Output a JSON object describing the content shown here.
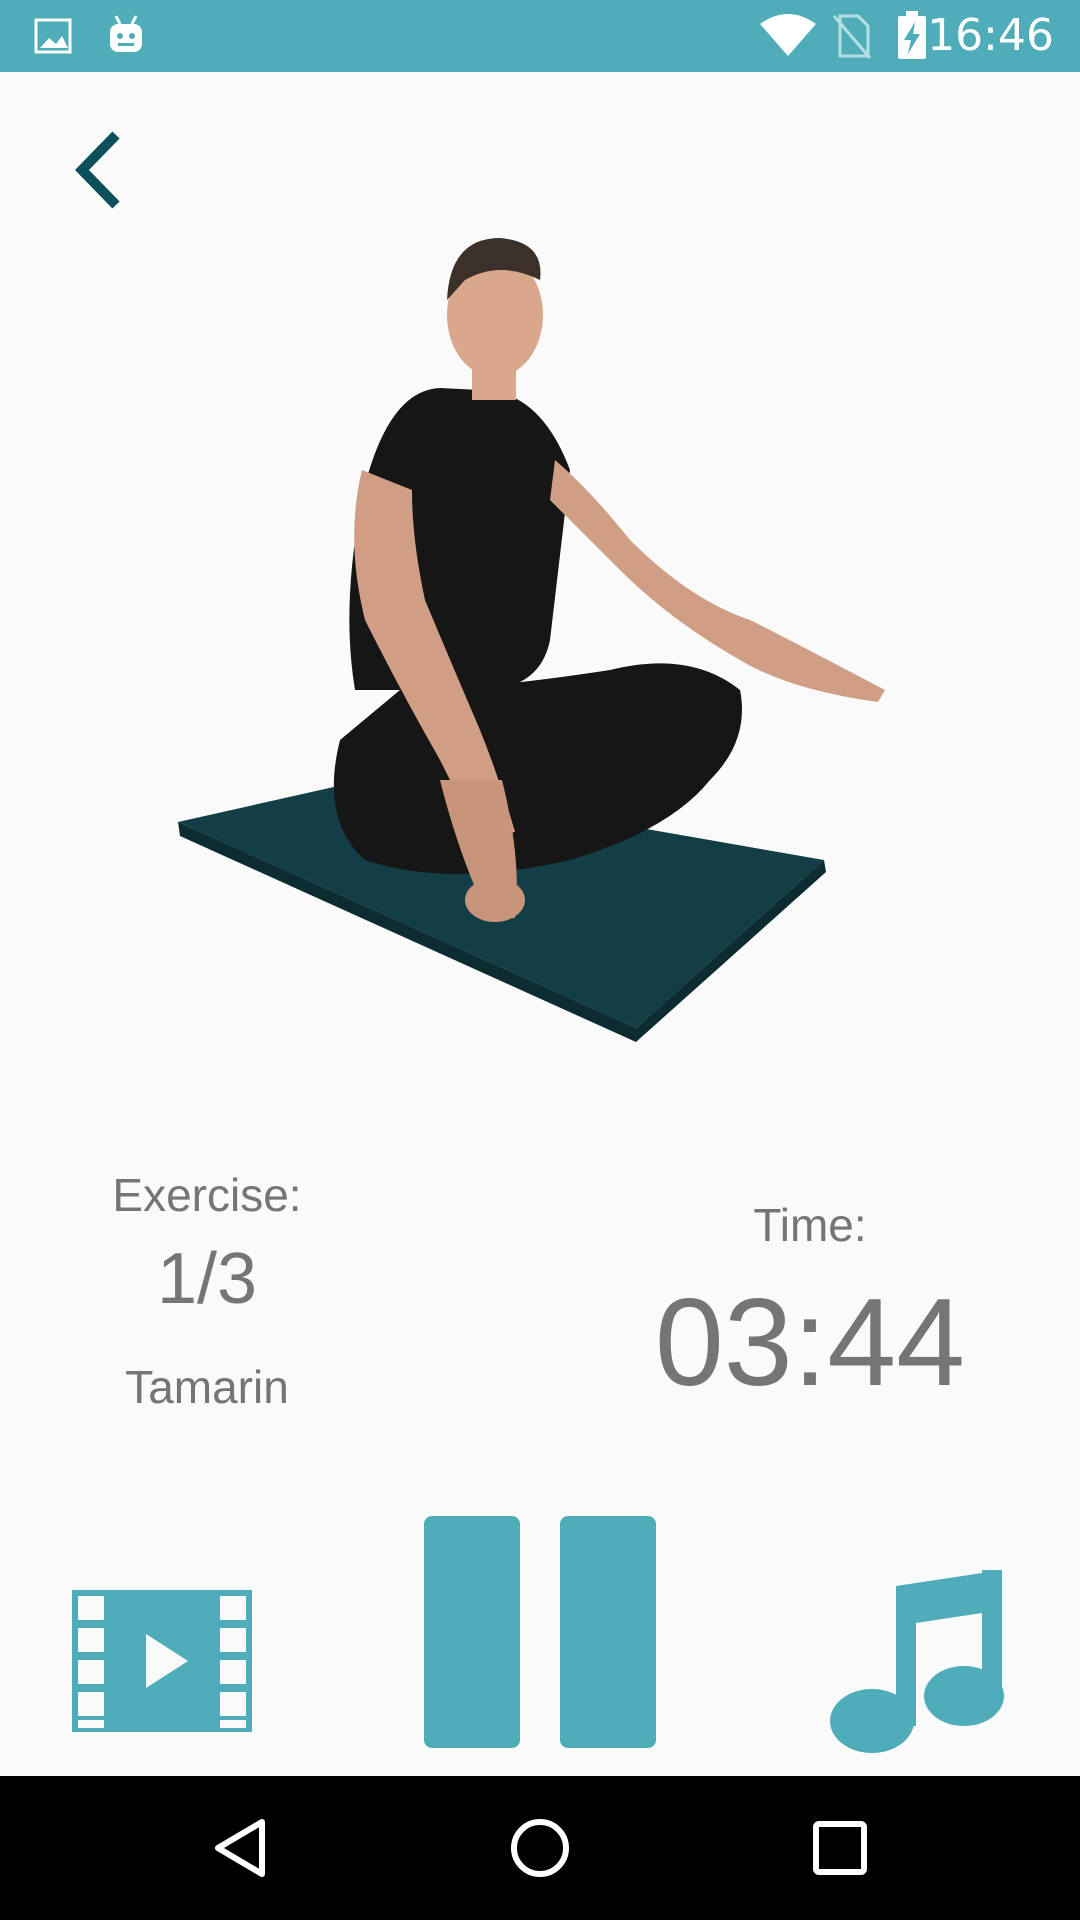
{
  "status_bar": {
    "time": "16:46",
    "background_color": "#4eadb8",
    "icons": [
      "gallery-notification-icon",
      "android-notification-icon",
      "wifi-icon",
      "no-sim-icon",
      "battery-charging-icon"
    ]
  },
  "header": {
    "back_icon": "chevron-left-icon"
  },
  "exercise": {
    "label": "Exercise:",
    "count": "1/3",
    "name": "Tamarin"
  },
  "timer": {
    "label": "Time:",
    "value": "03:44"
  },
  "controls": {
    "accent_color": "#4eadb8",
    "video_icon": "video-play-icon",
    "pause_icon": "pause-icon",
    "music_icon": "music-note-icon"
  },
  "nav_bar": {
    "icons": [
      "back-triangle-icon",
      "home-circle-icon",
      "recents-square-icon"
    ]
  },
  "colors": {
    "text": "#757575",
    "back_arrow": "#0d4f5a",
    "mat": "#133e45"
  }
}
